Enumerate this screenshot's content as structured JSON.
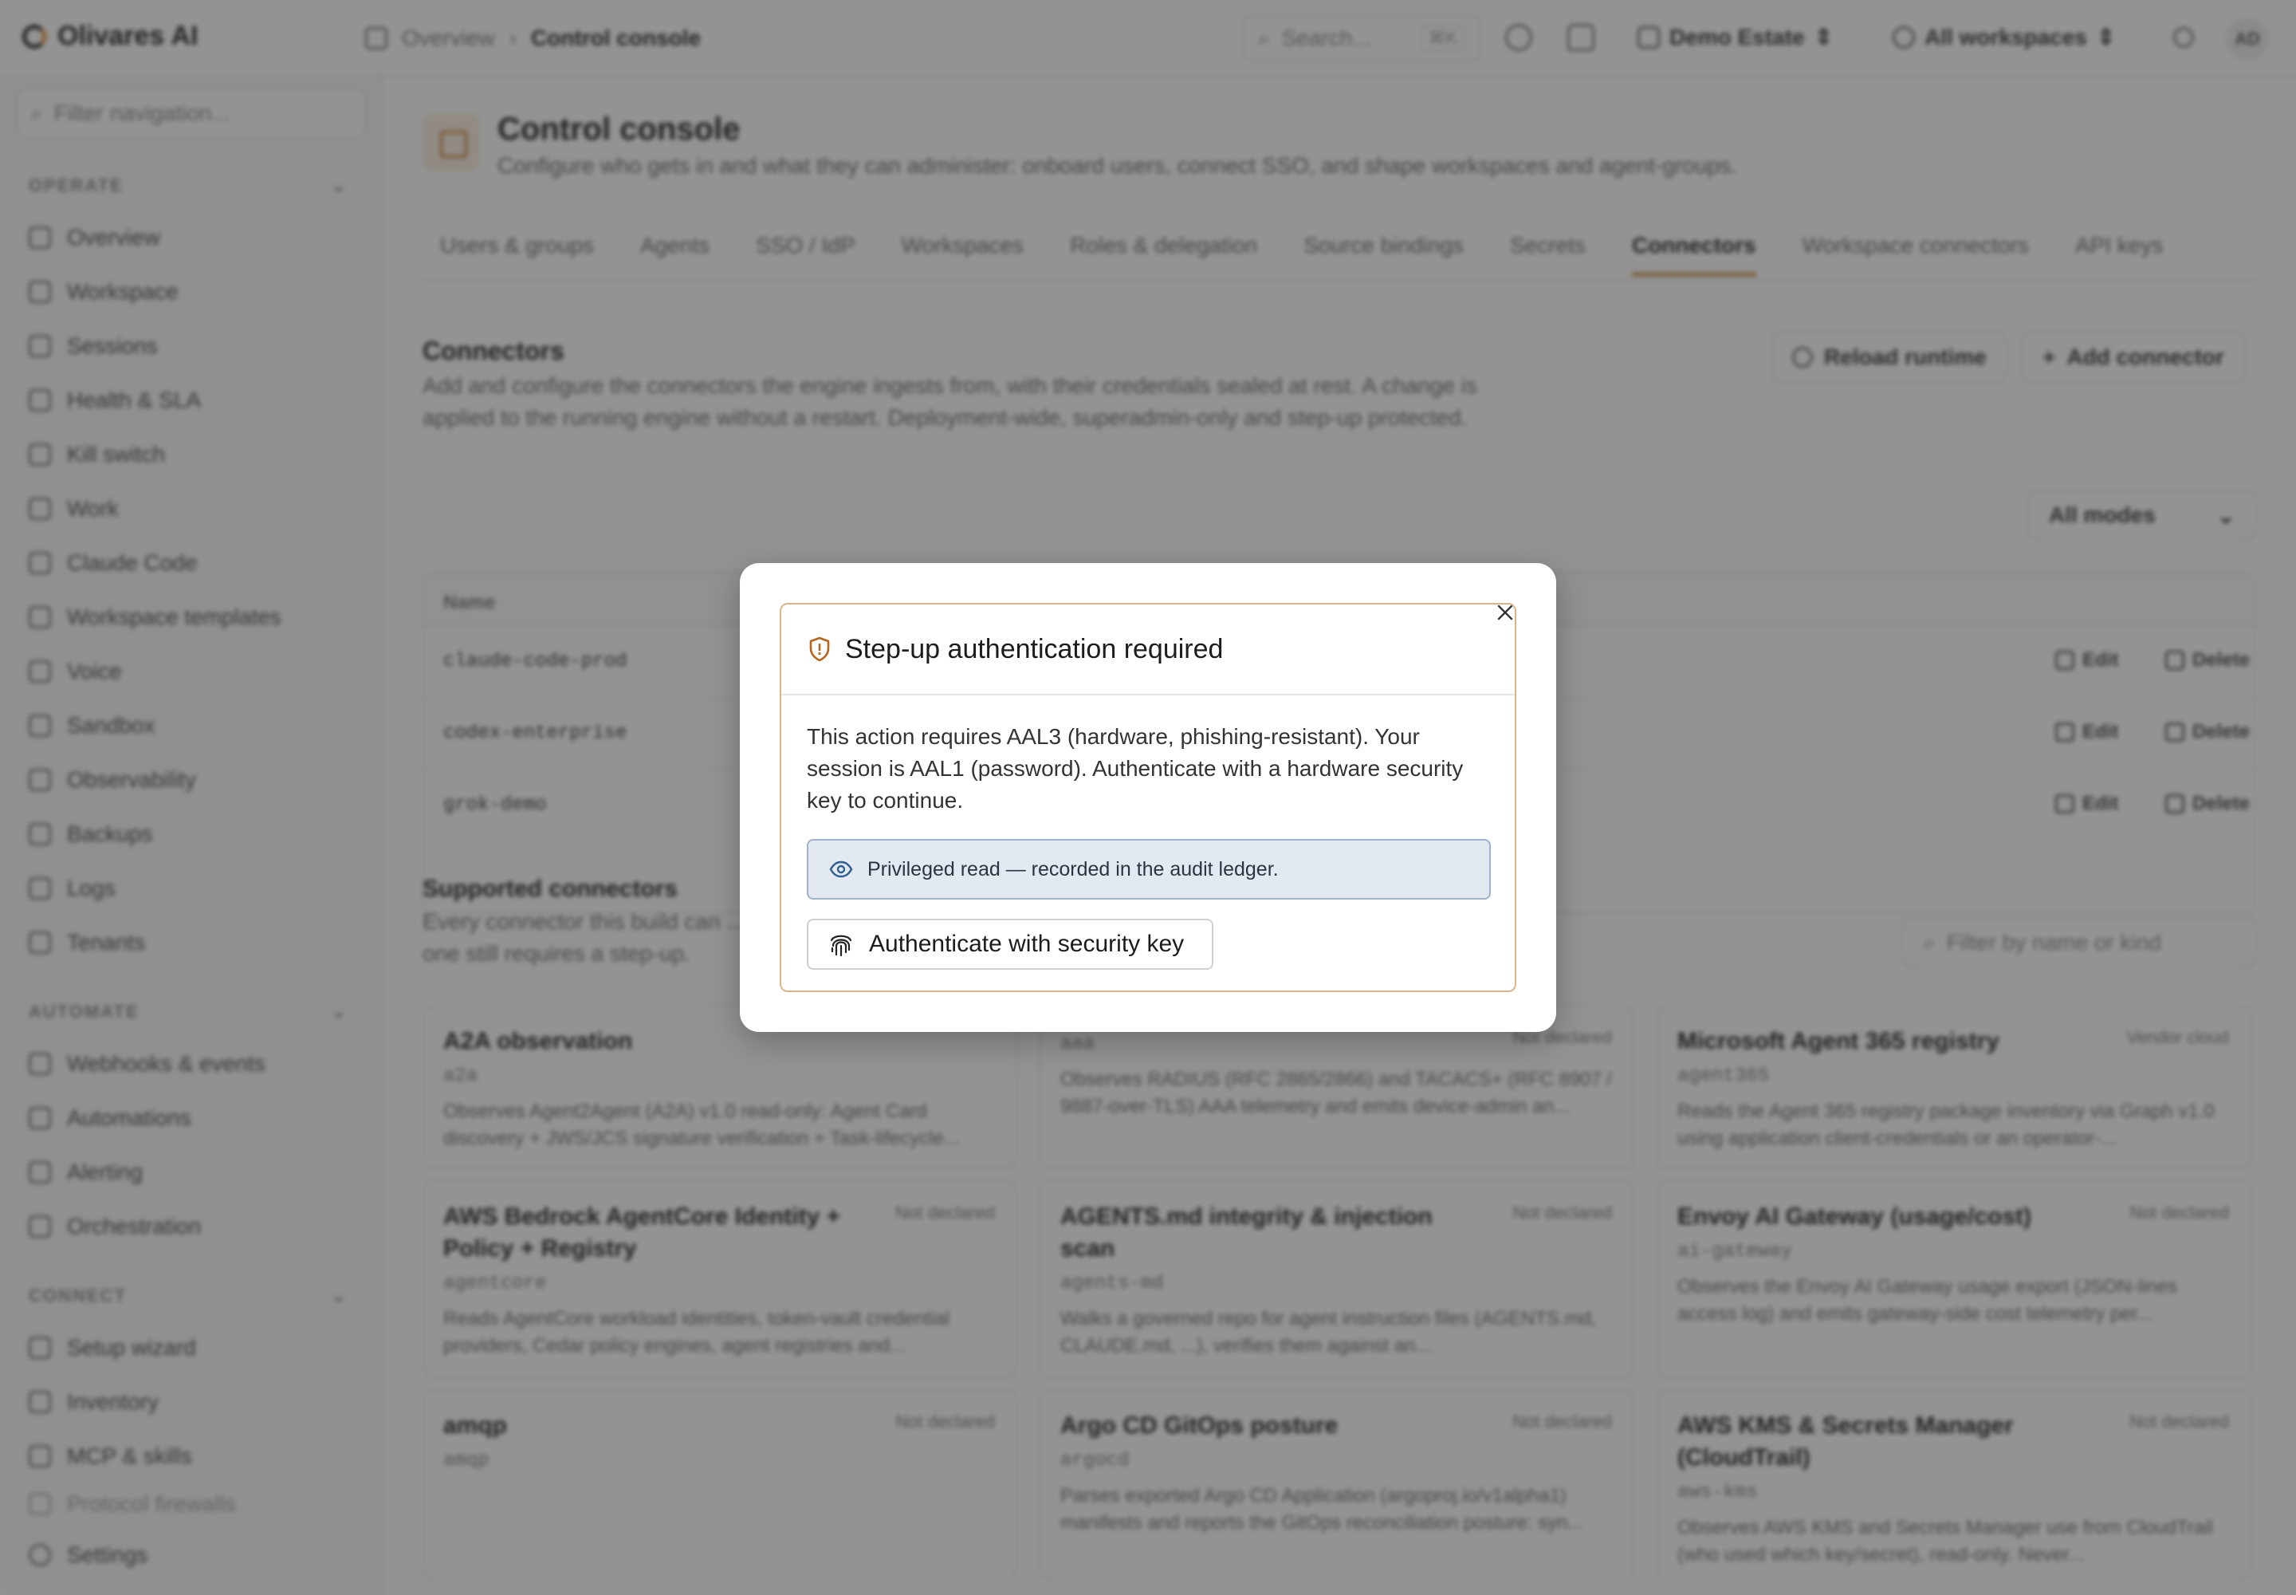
{
  "app": {
    "brand": "Olivares AI",
    "breadcrumb": [
      "Overview",
      "Control console"
    ],
    "search_placeholder": "Search...",
    "search_shortcut": "⌘K",
    "tenant_selector": "Demo Estate",
    "workspace_selector": "All workspaces",
    "user_initials": "AD"
  },
  "sidebar": {
    "filter_placeholder": "Filter navigation...",
    "sections": [
      {
        "title": "OPERATE",
        "items": [
          "Overview",
          "Workspace",
          "Sessions",
          "Health & SLA",
          "Kill switch",
          "Work",
          "Claude Code",
          "Workspace templates",
          "Voice",
          "Sandbox",
          "Observability",
          "Backups",
          "Logs",
          "Tenants"
        ]
      },
      {
        "title": "AUTOMATE",
        "items": [
          "Webhooks & events",
          "Automations",
          "Alerting",
          "Orchestration"
        ]
      },
      {
        "title": "CONNECT",
        "items": [
          "Setup wizard",
          "Inventory",
          "MCP & skills",
          "Protocol firewalls"
        ]
      }
    ],
    "footer_item": "Settings"
  },
  "page": {
    "title": "Control console",
    "subtitle": "Configure who gets in and what they can administer: onboard users, connect SSO, and shape workspaces and agent-groups.",
    "tabs": [
      "Users & groups",
      "Agents",
      "SSO / IdP",
      "Workspaces",
      "Roles & delegation",
      "Source bindings",
      "Secrets",
      "Connectors",
      "Workspace connectors",
      "API keys"
    ],
    "active_tab": "Connectors"
  },
  "connectors": {
    "title": "Connectors",
    "description": "Add and configure the connectors the engine ingests from, with their credentials sealed at rest. A change is applied to the running engine without a restart. Deployment-wide, superadmin-only and step-up protected.",
    "reload_button": "Reload runtime",
    "add_button": "Add connector",
    "mode_filter": "All modes",
    "table_header": "Name",
    "rows": [
      "claude-code-prod",
      "codex-enterprise",
      "grok-demo"
    ],
    "edit_label": "Edit",
    "delete_label": "Delete"
  },
  "supported": {
    "title": "Supported connectors",
    "description": "Every connector this build can ... one still requires a step-up.",
    "filter_placeholder": "Filter by name or kind",
    "cards": [
      {
        "name": "A2A observation",
        "kind": "a2a",
        "tag": "",
        "desc": "Observes Agent2Agent (A2A) v1.0 read-only: Agent Card discovery + JWS/JCS signature verification + Task-lifecycle..."
      },
      {
        "name": "",
        "kind": "aaa",
        "tag": "Not declared",
        "desc": "Observes RADIUS (RFC 2865/2866) and TACACS+ (RFC 8907 / 9887-over-TLS) AAA telemetry and emits device-admin an..."
      },
      {
        "name": "Microsoft Agent 365 registry",
        "kind": "agent365",
        "tag": "Vendor cloud",
        "desc": "Reads the Agent 365 registry package inventory via Graph v1.0 using application client-credentials or an operator-..."
      },
      {
        "name": "AWS Bedrock AgentCore Identity + Policy + Registry",
        "kind": "agentcore",
        "tag": "Not declared",
        "desc": "Reads AgentCore workload identities, token-vault credential providers, Cedar policy engines, agent registries and..."
      },
      {
        "name": "AGENTS.md integrity & injection scan",
        "kind": "agents-md",
        "tag": "Not declared",
        "desc": "Walks a governed repo for agent instruction files (AGENTS.md, CLAUDE.md, ...), verifies them against an..."
      },
      {
        "name": "Envoy AI Gateway (usage/cost)",
        "kind": "ai-gateway",
        "tag": "Not declared",
        "desc": "Observes the Envoy AI Gateway usage export (JSON-lines access log) and emits gateway-side cost telemetry per..."
      },
      {
        "name": "amqp",
        "kind": "amqp",
        "tag": "Not declared",
        "desc": ""
      },
      {
        "name": "Argo CD GitOps posture",
        "kind": "argocd",
        "tag": "Not declared",
        "desc": "Parses exported Argo CD Application (argoproj.io/v1alpha1) manifests and reports the GitOps reconciliation posture: syn..."
      },
      {
        "name": "AWS KMS & Secrets Manager (CloudTrail)",
        "kind": "aws-kms",
        "tag": "Not declared",
        "desc": "Observes AWS KMS and Secrets Manager use from CloudTrail (who used which key/secret), read-only. Never..."
      }
    ]
  },
  "modal": {
    "title": "Step-up authentication required",
    "description": "This action requires AAL3 (hardware, phishing-resistant). Your session is AAL1 (password). Authenticate with a hardware security key to continue.",
    "banner": "Privileged read — recorded in the audit ledger.",
    "button": "Authenticate with security key",
    "accent_color": "#b5651d",
    "banner_bg": "#e2e9f1"
  }
}
